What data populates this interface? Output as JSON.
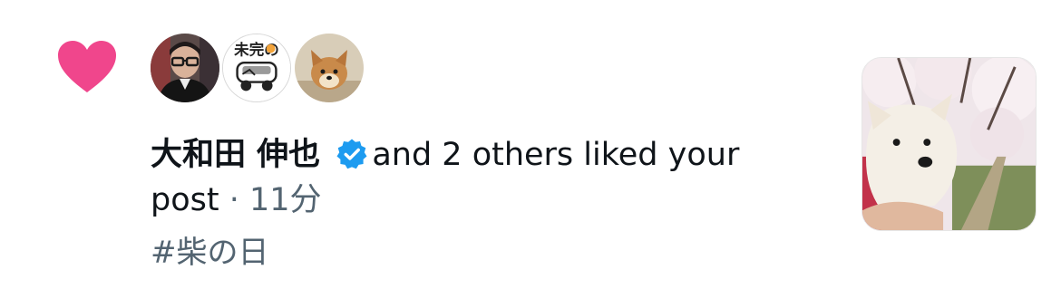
{
  "notification": {
    "type_icon": "heart-icon",
    "accent_color": "#f0468c",
    "verified_color": "#1d9bf0",
    "avatars": [
      "avatar-man-glasses",
      "avatar-cartoon-logo",
      "avatar-shiba-puppy"
    ],
    "avatar_logo_text": "未完の",
    "user_name": "大和田 伸也",
    "action_line1": "and 2 others liked your",
    "action_line2": "post",
    "separator": "·",
    "time": "11分",
    "post_text": "#柴の日",
    "thumbnail": "dog-under-cherry-blossoms"
  }
}
